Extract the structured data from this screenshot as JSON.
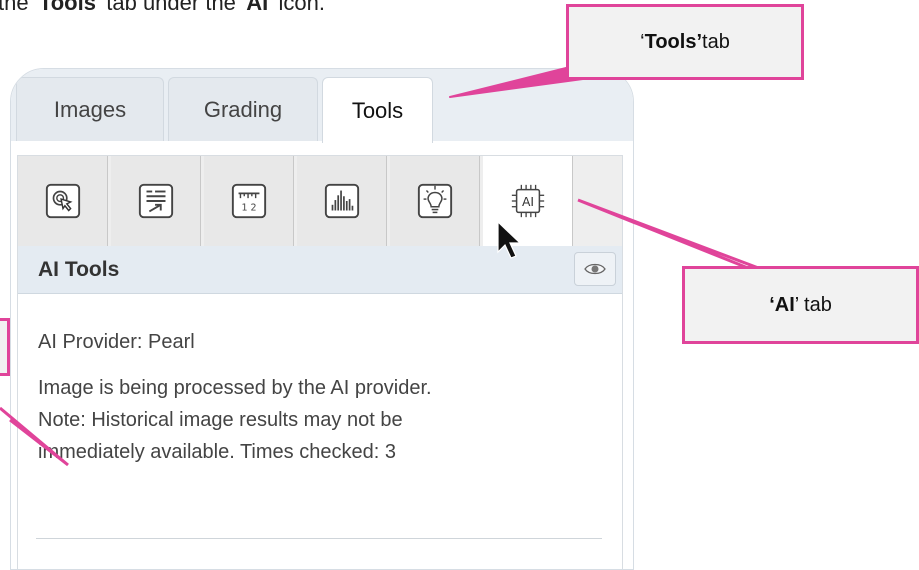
{
  "caption": {
    "prefix": "the '",
    "tools": "Tools",
    "middle": "' tab under the '",
    "ai": "AI",
    "suffix": "' icon."
  },
  "tabs": [
    {
      "label": "Images"
    },
    {
      "label": "Grading"
    },
    {
      "label": "Tools",
      "active": true
    }
  ],
  "toolbar": {
    "buttons": [
      {
        "icon": "cursor-click-icon"
      },
      {
        "icon": "report-export-icon"
      },
      {
        "icon": "ruler-measure-icon"
      },
      {
        "icon": "histogram-icon"
      },
      {
        "icon": "lightbulb-icon"
      },
      {
        "icon": "ai-chip-icon",
        "label": "AI",
        "active": true
      }
    ]
  },
  "section": {
    "title": "AI Tools",
    "eye_icon": "eye-icon"
  },
  "content": {
    "provider": "AI Provider: Pearl",
    "status_lines": [
      "Image is being processed by the AI provider.",
      "Note: Historical image results may not be",
      "immediately available. Times checked: 3"
    ]
  },
  "callouts": {
    "tools": {
      "open": "‘",
      "bold": "Tools’",
      "rest": " tab"
    },
    "ai": {
      "bold": "‘AI",
      "rest": "’ tab"
    }
  },
  "colors": {
    "callout_border": "#e0449a",
    "header_bg": "#e4ebf2"
  }
}
